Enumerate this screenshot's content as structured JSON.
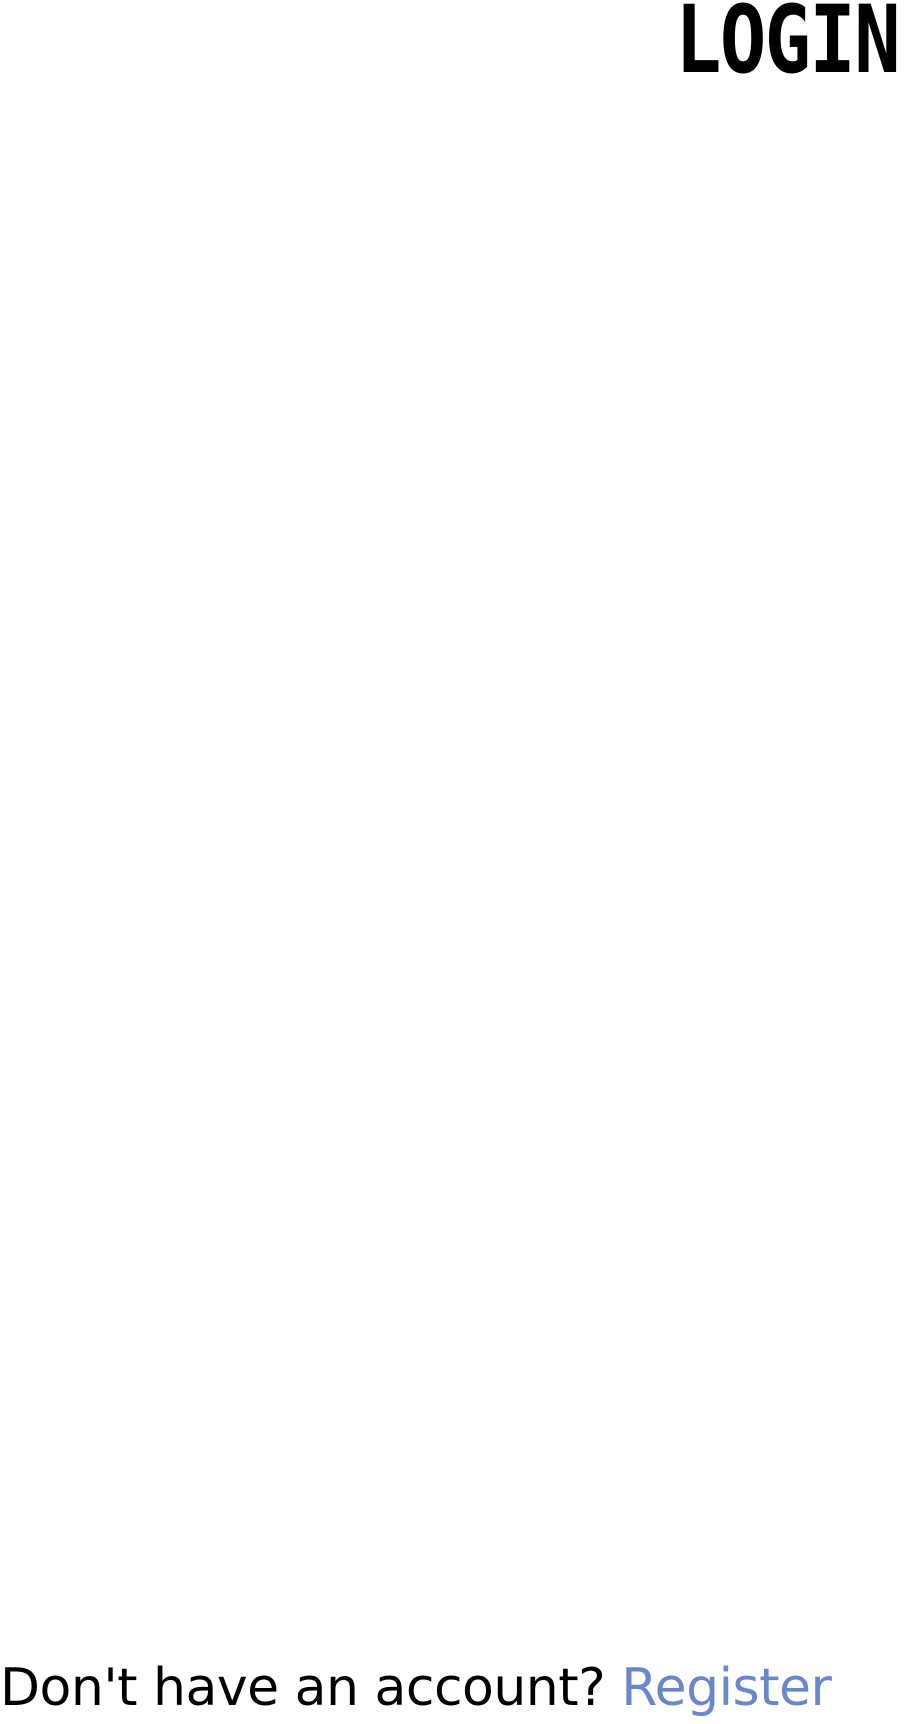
{
  "header": {
    "title": "LOGIN"
  },
  "footer": {
    "prompt_text": "Don't have an account?",
    "register_label": "Register"
  },
  "colors": {
    "text": "#000000",
    "link": "#6b87cc",
    "background": "#ffffff"
  }
}
